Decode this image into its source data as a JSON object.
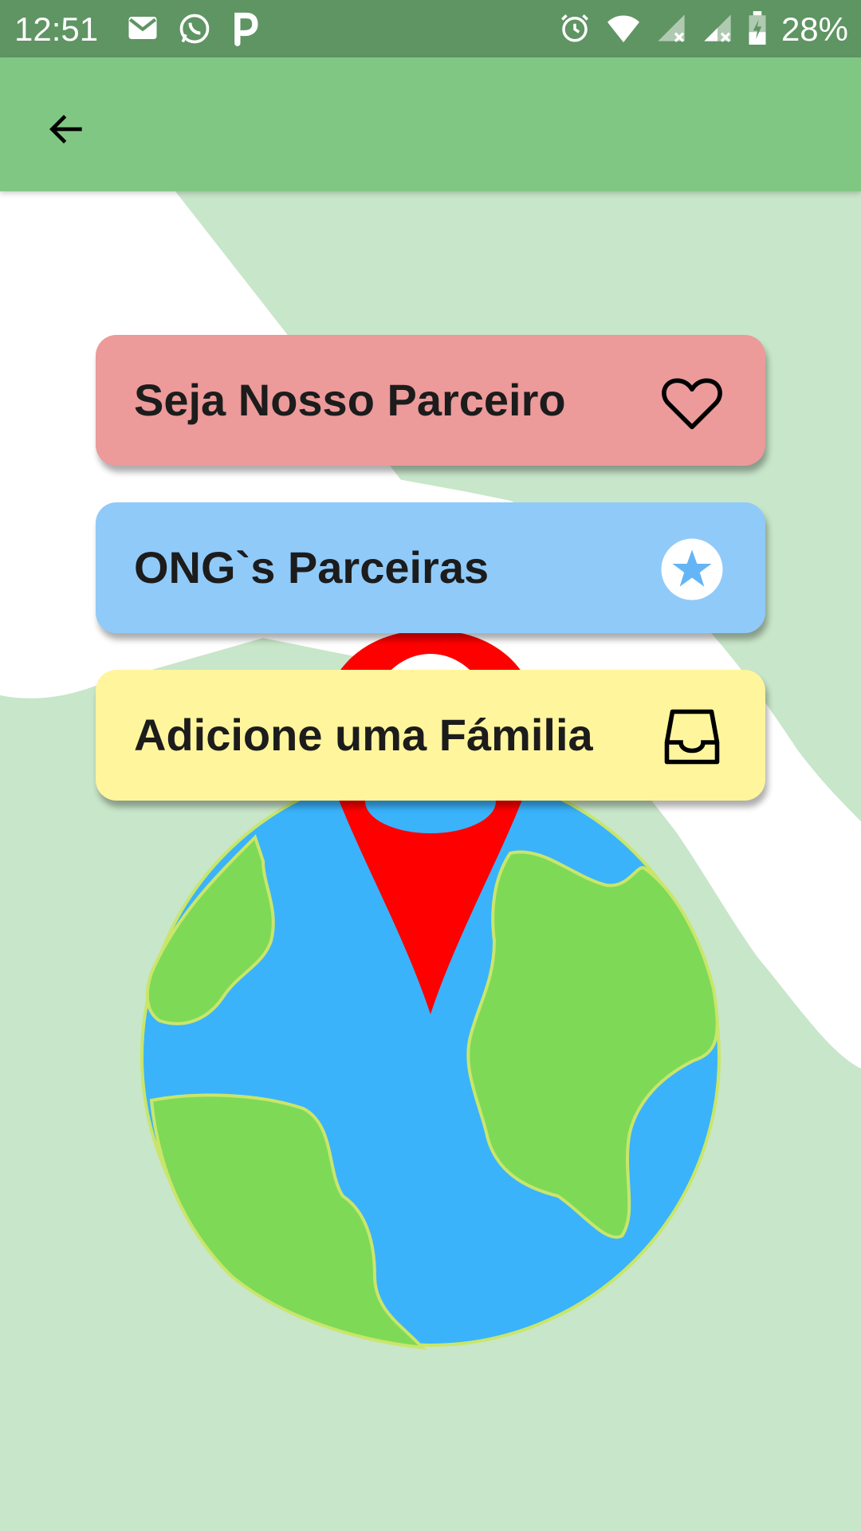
{
  "status_bar": {
    "time": "12:51",
    "battery_percent": "28%",
    "left_icons": [
      "gmail-icon",
      "whatsapp-icon",
      "p-app-icon"
    ],
    "right_icons": [
      "alarm-icon",
      "wifi-icon",
      "signal-icon",
      "signal-icon",
      "battery-charging-icon"
    ]
  },
  "app_bar": {
    "back_icon": "arrow-left-icon",
    "color": "#81c784"
  },
  "menu": {
    "items": [
      {
        "label": "Seja Nosso Parceiro",
        "icon": "heart-outline-icon",
        "color": "#ec9a9a"
      },
      {
        "label": "ONG`s Parceiras",
        "icon": "star-circle-icon",
        "color": "#90caf9"
      },
      {
        "label": "Adicione uma Fámilia",
        "icon": "inbox-tray-icon",
        "color": "#fff59d"
      }
    ]
  },
  "illustration": {
    "name": "globe-with-location-pin",
    "colors": {
      "ocean": "#3ab3fb",
      "land": "#7ed957",
      "pin": "#ff0000",
      "background_blob": "#c8e6c9"
    }
  }
}
